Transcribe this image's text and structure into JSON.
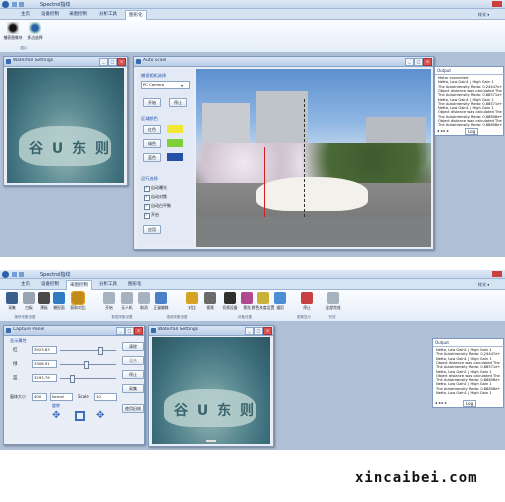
{
  "top_app": {
    "title": "Spectrol指纹",
    "tabs": [
      "主页",
      "设备控制",
      "采图控制",
      "分析工具",
      "图形化"
    ],
    "active_tab": 4,
    "right_label": "样式 ▾",
    "ribbon_buttons": [
      "捕获图像块",
      "多边选择"
    ],
    "ribbon_group": "图片"
  },
  "waterfall_top": {
    "title": "Waterfall Settings",
    "buttons": [
      "_",
      "□",
      "×"
    ]
  },
  "auto_scale": {
    "title": "Auto scale",
    "buttons": [
      "_",
      "□",
      "×"
    ],
    "camera_section": "捕捉相机选择",
    "camera_select": "PC Camera",
    "start_btn": "开始",
    "stop_btn": "停止",
    "color_section": "区域颜色",
    "color_rows": [
      "红色",
      "绿色",
      "蓝色"
    ],
    "swatch_colors": [
      "#f2e733",
      "#7fcf3a",
      "#2550a8"
    ],
    "option_section": "运行选择",
    "options": [
      "自动曝光",
      "自动对焦",
      "自动白平衡",
      "开启"
    ],
    "apply_btn": "应用"
  },
  "output_top": {
    "title": "Output",
    "lines": [
      "Motor connected",
      "Netto, Low Gain1 | High Gain 1",
      "The AutoIntensity Redo: 0.24447e+",
      "Object distance was calculated The",
      "The AutoIntensity Redo: 0.88571e+",
      "Netto, Low Gain1 | High Gain 1",
      "The AutoIntensity Redo: 0.88571e+",
      "Netto, Low Gain1 | High Gain 1",
      "Object distance was calculated The",
      "The AutoIntensity Redo: 0.88808e+",
      "Object distance was calculated The",
      "The AutoIntensity Redo: 0.88808e+"
    ],
    "tab": "Log"
  },
  "bottom_app": {
    "title": "Spectrol指纹",
    "tabs": [
      "主页",
      "设备控制",
      "采图控制",
      "分析工具",
      "图形化"
    ],
    "active_tab": 2,
    "right_label": "样式 ▾",
    "ribbon_buttons": [
      "采集",
      "白板",
      "黑板",
      "捕捉面",
      "获取对比",
      "开始",
      "无人机",
      "取消",
      "正量偏移",
      "对比",
      "视频",
      "切换设备",
      "预览",
      "颜色灰度设置",
      "通用",
      "停止",
      "全部完成"
    ],
    "groups": [
      "捕获采集设置",
      "数据采集设置",
      "视频采集设置",
      "设备设置",
      "图像显示",
      "完成"
    ]
  },
  "capture_panel": {
    "title": "Capture Panel",
    "buttons": [
      "_",
      "□",
      "×"
    ],
    "section": "显示属性",
    "rows": [
      {
        "label": "红",
        "value": "3923.83"
      },
      {
        "label": "绿",
        "value": "3306.91"
      },
      {
        "label": "蓝",
        "value": "3293.79"
      }
    ],
    "side_btns": [
      "清除",
      "混合",
      "停止",
      "采集"
    ],
    "window_label": "窗体大小",
    "window_value": "400",
    "kernel_label": "Kernel",
    "scale_label": "Scale",
    "scale_value": "10",
    "rotate_label": "旋转",
    "apply_btn": "使用旧帧"
  },
  "waterfall_bottom": {
    "title": "Waterfall Settings",
    "buttons": [
      "_",
      "□",
      "×"
    ]
  },
  "output_bottom": {
    "title": "Output",
    "lines": [
      "Netto, Low Gain1 | High Gain 1",
      "The AutoIntensity Redo: 0.24447e+",
      "Netto, Low Gain1 | High Gain 1",
      "Object distance was calculated The",
      "The AutoIntensity Redo: 0.88571e+",
      "Netto, Low Gain1 | High Gain 1",
      "Object distance was calculated The",
      "The AutoIntensity Redo: 0.88808e+",
      "Netto, Low Gain1 | High Gain 1",
      "The AutoIntensity Redo: 0.88808e+",
      "Netto, Low Gain1 | High Gain 1"
    ],
    "tab": "Log"
  },
  "stone_text": "谷 U 东 则",
  "watermark": "xincaibei.com"
}
